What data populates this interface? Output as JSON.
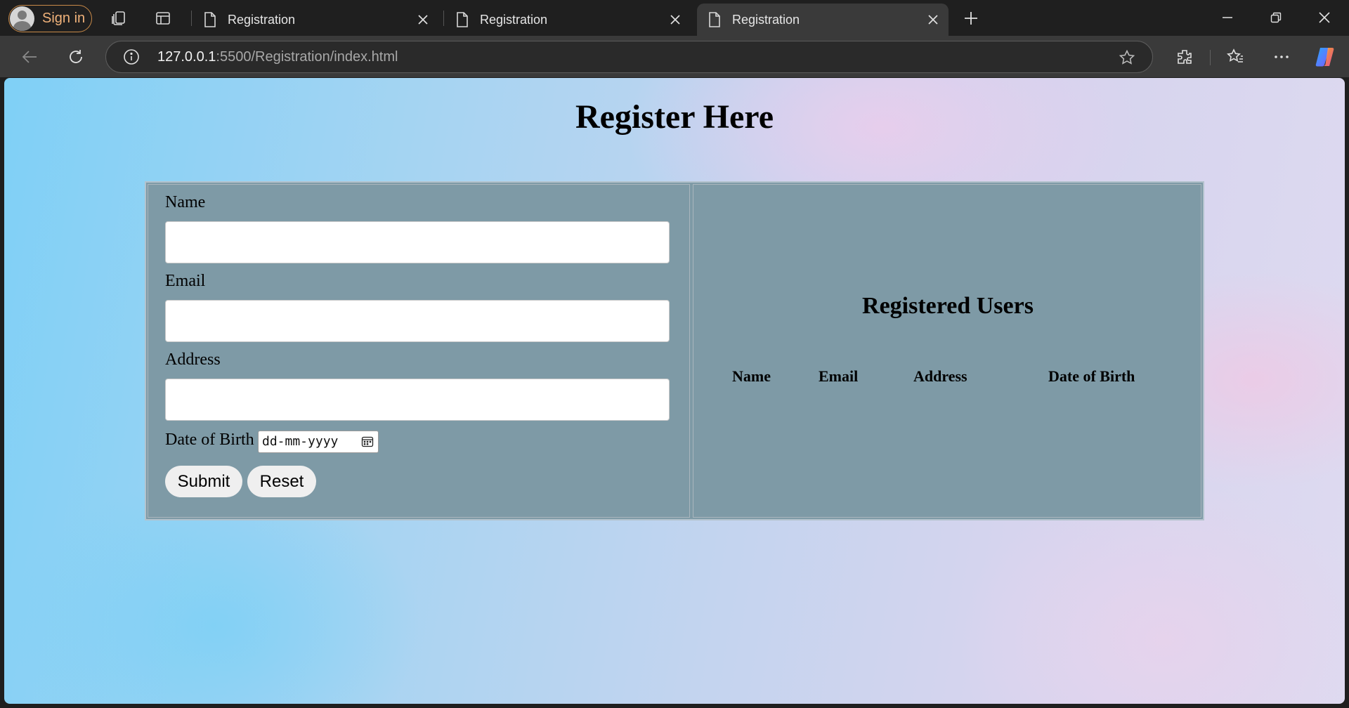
{
  "browser": {
    "sign_in_label": "Sign in",
    "tabs": [
      {
        "title": "Registration",
        "active": false
      },
      {
        "title": "Registration",
        "active": false
      },
      {
        "title": "Registration",
        "active": true
      }
    ],
    "url_host": "127.0.0.1",
    "url_rest": ":5500/Registration/index.html"
  },
  "page": {
    "heading": "Register Here",
    "form": {
      "name_label": "Name",
      "email_label": "Email",
      "address_label": "Address",
      "dob_label": "Date of Birth",
      "dob_placeholder": "dd-mm-yyyy",
      "name_value": "",
      "email_value": "",
      "address_value": "",
      "submit_label": "Submit",
      "reset_label": "Reset"
    },
    "users": {
      "title": "Registered Users",
      "columns": [
        "Name",
        "Email",
        "Address",
        "Date of Birth"
      ]
    }
  },
  "colors": {
    "panel_bg": "#7e9aa6",
    "signin_accent": "#f0b27a"
  }
}
